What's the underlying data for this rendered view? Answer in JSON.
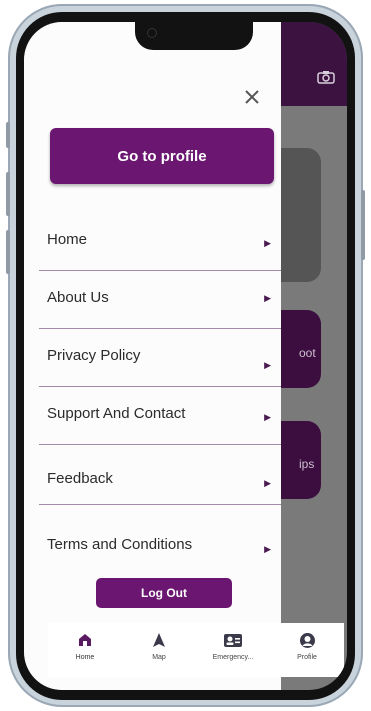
{
  "drawer": {
    "close_icon": "close-icon",
    "profile_button": "Go to profile",
    "items": [
      {
        "label": "Home"
      },
      {
        "label": "About Us"
      },
      {
        "label": "Privacy Policy"
      },
      {
        "label": "Support And Contact"
      },
      {
        "label": "Feedback"
      },
      {
        "label": "Terms and Conditions"
      }
    ],
    "logout_button": "Log Out"
  },
  "background": {
    "card1_text": "oot",
    "card2_text": "ips",
    "camera_icon": "camera-icon"
  },
  "bottom_nav": {
    "items": [
      {
        "label": "Home",
        "icon": "home-icon",
        "active": true
      },
      {
        "label": "Map",
        "icon": "map-icon"
      },
      {
        "label": "Emergency...",
        "icon": "contact-card-icon"
      },
      {
        "label": "Profile",
        "icon": "profile-icon"
      }
    ]
  },
  "colors": {
    "accent": "#6b1772",
    "header_bg": "#3b1240",
    "divider": "#a58aac"
  }
}
